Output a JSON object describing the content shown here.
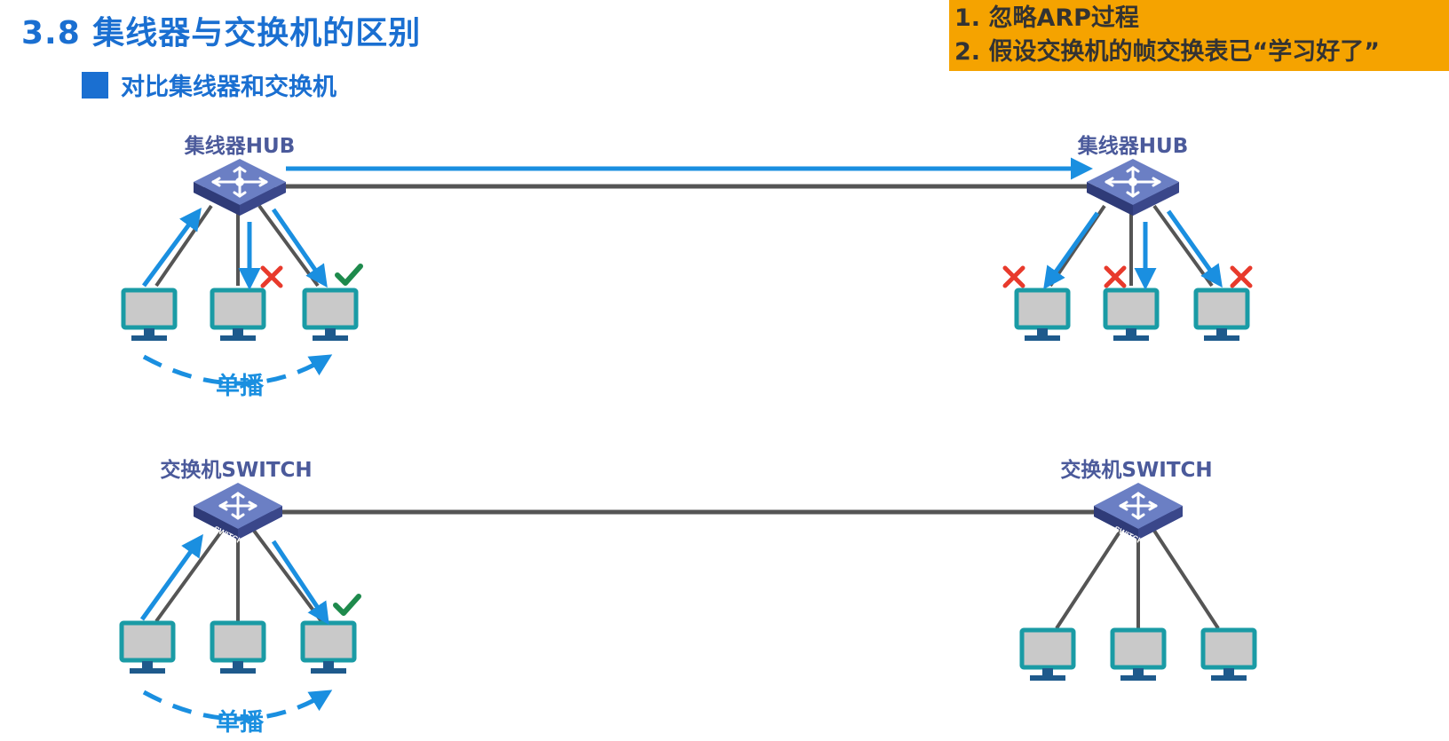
{
  "header": {
    "title": "3.8 集线器与交换机的区别",
    "subtitle": "对比集线器和交换机"
  },
  "notes": {
    "lines": [
      "1. 忽略ARP过程",
      "2. 假设交换机的帧交换表已“学习好了”"
    ]
  },
  "diagram": {
    "hub_label": "集线器HUB",
    "switch_label": "交换机SWITCH",
    "unicast_label": "单播",
    "device_badge_text": "SWITCH"
  },
  "colors": {
    "title_blue": "#1a6fd1",
    "device_label": "#4b5a9b",
    "arrow_blue": "#1a8fe0",
    "note_bg": "#f5a300",
    "cross_red": "#e83a2c",
    "check_green": "#1e8a4c",
    "monitor_teal": "#1a9ba5",
    "link_gray": "#555555"
  },
  "icons": [
    "hub-icon",
    "switch-icon",
    "computer-icon",
    "cross-icon",
    "check-icon",
    "arrow"
  ]
}
